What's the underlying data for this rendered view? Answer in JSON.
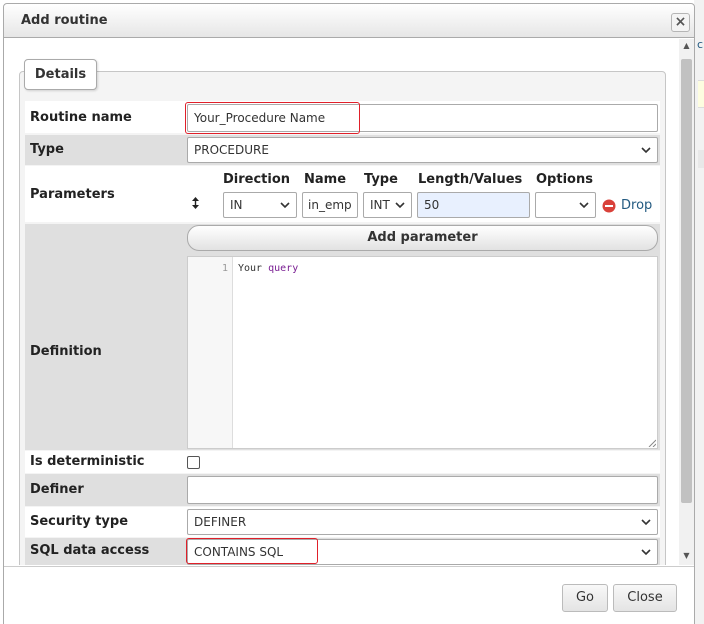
{
  "dialog": {
    "title": "Add routine"
  },
  "tabs": {
    "details_label": "Details"
  },
  "routine_name": {
    "label": "Routine name",
    "value": "Your_Procedure Name"
  },
  "type": {
    "label": "Type",
    "value": "PROCEDURE"
  },
  "parameters": {
    "label": "Parameters",
    "headers": {
      "direction": "Direction",
      "name": "Name",
      "type": "Type",
      "length": "Length/Values",
      "options": "Options"
    },
    "row": {
      "direction": "IN",
      "name": "in_emp",
      "type": "INT",
      "length": "50",
      "options": ""
    },
    "drop_label": "Drop",
    "add_label": "Add parameter"
  },
  "definition": {
    "label": "Definition",
    "line_number": "1",
    "code_text": "Your",
    "code_keyword": "query"
  },
  "deterministic": {
    "label": "Is deterministic"
  },
  "definer": {
    "label": "Definer",
    "value": ""
  },
  "security_type": {
    "label": "Security type",
    "value": "DEFINER"
  },
  "sql_data_access": {
    "label": "SQL data access",
    "value": "CONTAINS SQL"
  },
  "footer": {
    "go_label": "Go",
    "close_label": "Close"
  },
  "backdrop": {
    "partial_letter": "c"
  },
  "colors": {
    "accent_link": "#235a81",
    "annotation": "#e0202a",
    "highlight_input": "#e8f0fe",
    "drop_icon": "#d9413a"
  }
}
